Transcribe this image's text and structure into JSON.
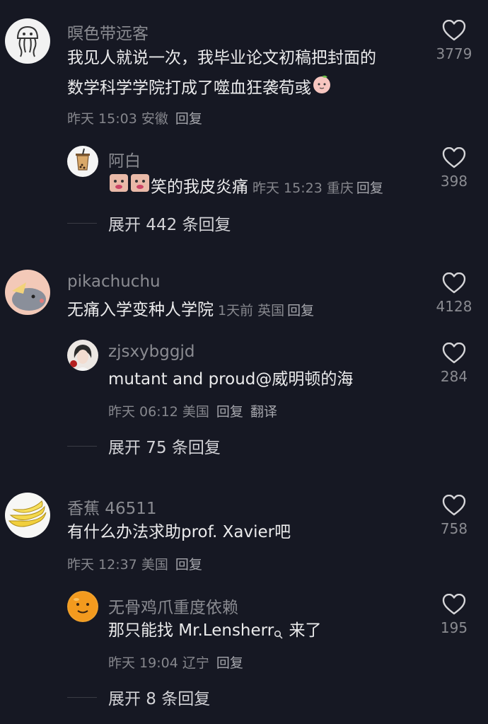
{
  "comments": [
    {
      "user": "暝色带远客",
      "text_lines": [
        "我见人就说一次，我毕业论文初稿把封面的",
        "数学科学学院打成了噬血狂袭荀彧"
      ],
      "time": "昨天 15:03",
      "location": "安徽",
      "reply_label": "回复",
      "likes": "3779",
      "avatar_icon": "jellyfish-icon",
      "reply": {
        "user": "阿白",
        "text": "笑的我皮炎痛",
        "time": "昨天 15:23",
        "location": "重庆",
        "reply_label": "回复",
        "likes": "398",
        "avatar_icon": "bubble-tea-icon"
      },
      "expand_label": "展开 442 条回复"
    },
    {
      "user": "pikachuchu",
      "text_lines": [
        "无痛入学变种人学院"
      ],
      "time": "1天前",
      "location": "英国",
      "reply_label": "回复",
      "likes": "4128",
      "avatar_icon": "cartoon-mouse-icon",
      "reply": {
        "user": "zjsxybggjd",
        "text": "mutant and proud@威明顿的海",
        "time": "昨天 06:12",
        "location": "美国",
        "reply_label": "回复",
        "translate_label": "翻译",
        "likes": "284",
        "avatar_icon": "portrait-icon"
      },
      "expand_label": "展开 75 条回复"
    },
    {
      "user": "香蕉 46511",
      "text_lines": [
        "有什么办法求助prof. Xavier吧"
      ],
      "time": "昨天 12:37",
      "location": "美国",
      "reply_label": "回复",
      "likes": "758",
      "avatar_icon": "banana-icon",
      "reply": {
        "user": "无骨鸡爪重度依赖",
        "text_before": "那只能找 Mr.Lensherr",
        "text_after": " 来了",
        "time": "昨天 19:04",
        "location": "辽宁",
        "reply_label": "回复",
        "likes": "195",
        "avatar_icon": "orange-face-icon"
      },
      "expand_label": "展开 8 条回复"
    }
  ],
  "colors": {
    "background": "#161823",
    "username": "#8a8b91",
    "comment_text": "#ebebec",
    "meta": "#86878d"
  }
}
